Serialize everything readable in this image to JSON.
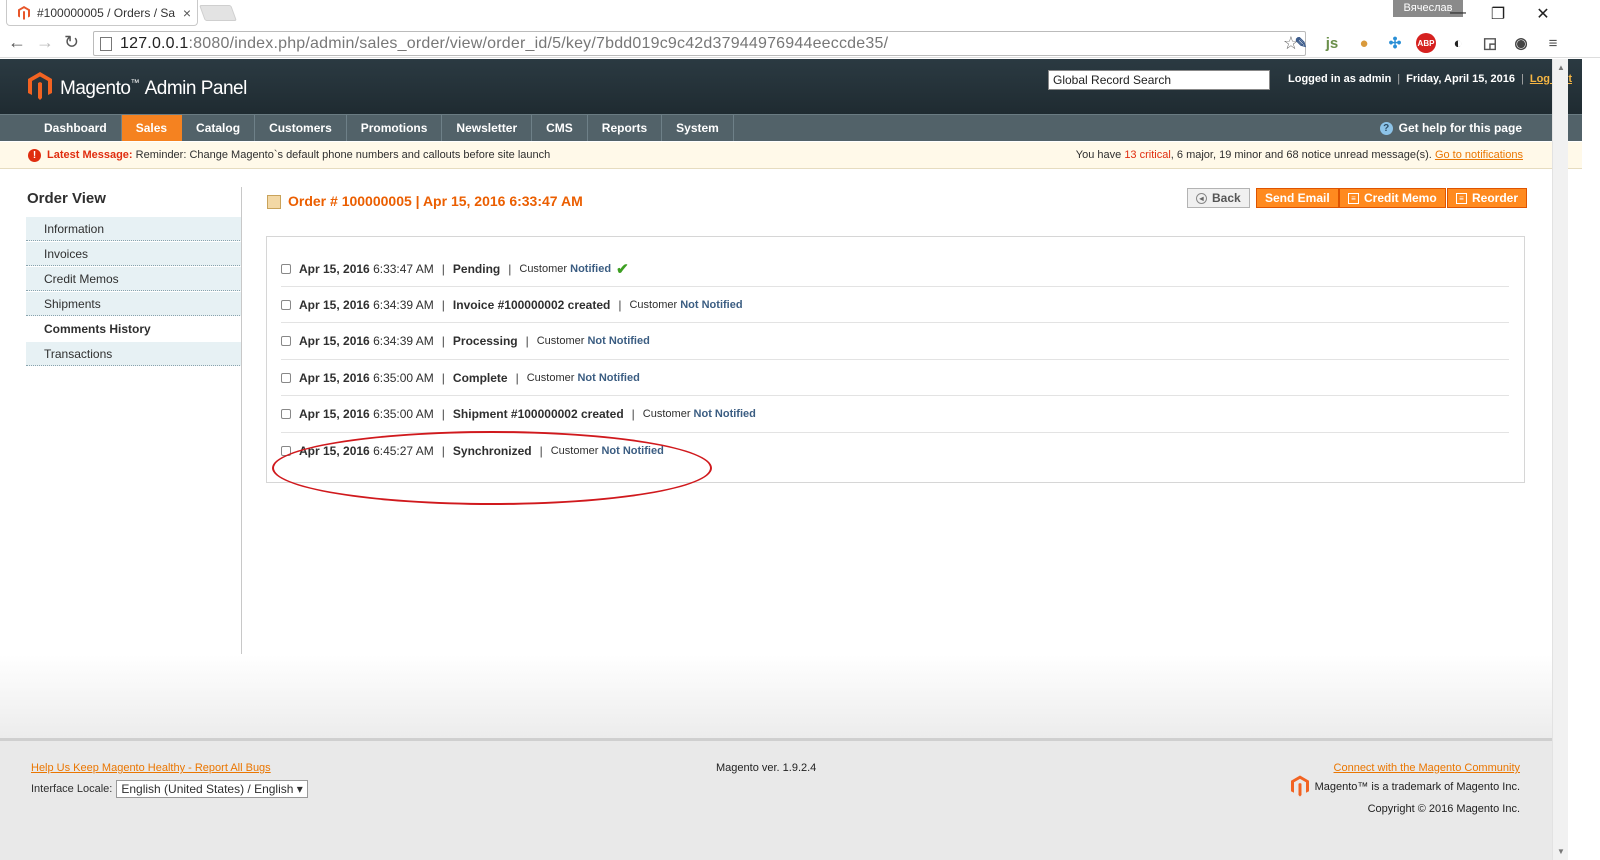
{
  "browser": {
    "tab_title": "#100000005 / Orders / Sa",
    "tab_close": "×",
    "profile_name": "Вячеслав",
    "url_host": "127.0.0.1",
    "url_rest": ":8080/index.php/admin/sales_order/view/order_id/5/key/7bdd019c9c42d37944976944eeccde35/",
    "win_min": "—",
    "win_restore": "❐",
    "win_close": "✕",
    "nav_back": "←",
    "nav_forward": "→",
    "nav_reload": "↻",
    "star": "☆",
    "extensions": [
      {
        "icon": "eyedropper-icon",
        "glyph": "✎",
        "color": "#3a5a8a"
      },
      {
        "icon": "js-icon",
        "glyph": "js",
        "color": "#6a8f4a"
      },
      {
        "icon": "cookie-icon",
        "glyph": "●",
        "color": "#d99a3c"
      },
      {
        "icon": "network-icon",
        "glyph": "✣",
        "color": "#2a8fd6"
      },
      {
        "icon": "adblock-icon",
        "glyph": "ABP",
        "color": "#d6211f"
      },
      {
        "icon": "contrast-icon",
        "glyph": "◐",
        "color": "#222"
      },
      {
        "icon": "rss-icon",
        "glyph": "◲",
        "color": "#555"
      },
      {
        "icon": "eye-off-icon",
        "glyph": "◉",
        "color": "#444"
      },
      {
        "icon": "menu-icon",
        "glyph": "≡",
        "color": "#555"
      }
    ]
  },
  "header": {
    "brand": "Magento",
    "brand_suffix": "Admin Panel",
    "search_value": "Global Record Search",
    "logged_in": "Logged in as admin",
    "date": "Friday, April 15, 2016",
    "logout": "Log Out"
  },
  "nav": {
    "items": [
      "Dashboard",
      "Sales",
      "Catalog",
      "Customers",
      "Promotions",
      "Newsletter",
      "CMS",
      "Reports",
      "System"
    ],
    "active_index": 1,
    "help": "Get help for this page"
  },
  "message": {
    "label": "Latest Message:",
    "text": "Reminder: Change Magento`s default phone numbers and callouts before site launch",
    "right_prefix": "You have",
    "critical": "13 critical",
    "rest": ", 6 major, 19 minor and 68 notice unread message(s).",
    "link": "Go to notifications"
  },
  "sidebar": {
    "title": "Order View",
    "items": [
      "Information",
      "Invoices",
      "Credit Memos",
      "Shipments",
      "Comments History",
      "Transactions"
    ],
    "active_index": 4
  },
  "order": {
    "title": "Order # 100000005 | Apr 15, 2016 6:33:47 AM",
    "buttons": {
      "back": "Back",
      "send_email": "Send Email",
      "credit_memo": "Credit Memo",
      "reorder": "Reorder"
    }
  },
  "history": [
    {
      "date": "Apr 15, 2016",
      "time": "6:33:47 AM",
      "status": "Pending",
      "customer": "Customer",
      "notified": "Notified",
      "check": "✔"
    },
    {
      "date": "Apr 15, 2016",
      "time": "6:34:39 AM",
      "status": "Invoice #100000002 created",
      "customer": "Customer",
      "notified": "Not Notified",
      "check": ""
    },
    {
      "date": "Apr 15, 2016",
      "time": "6:34:39 AM",
      "status": "Processing",
      "customer": "Customer",
      "notified": "Not Notified",
      "check": ""
    },
    {
      "date": "Apr 15, 2016",
      "time": "6:35:00 AM",
      "status": "Complete",
      "customer": "Customer",
      "notified": "Not Notified",
      "check": ""
    },
    {
      "date": "Apr 15, 2016",
      "time": "6:35:00 AM",
      "status": "Shipment #100000002 created",
      "customer": "Customer",
      "notified": "Not Notified",
      "check": ""
    },
    {
      "date": "Apr 15, 2016",
      "time": "6:45:27 AM",
      "status": "Synchronized",
      "customer": "Customer",
      "notified": "Not Notified",
      "check": ""
    }
  ],
  "footer": {
    "bug_link": "Help Us Keep Magento Healthy - Report All Bugs",
    "locale_label": "Interface Locale:",
    "locale_value": "English (United States) / English",
    "version": "Magento ver. 1.9.2.4",
    "community_link": "Connect with the Magento Community",
    "trademark": "Magento™ is a trademark of Magento Inc.",
    "copyright": "Copyright © 2016 Magento Inc."
  },
  "colors": {
    "accent": "#f58220",
    "header_bg": "#26333a",
    "nav_bg": "#526269",
    "critical": "#e02d0f",
    "annotation": "#d0191d"
  }
}
